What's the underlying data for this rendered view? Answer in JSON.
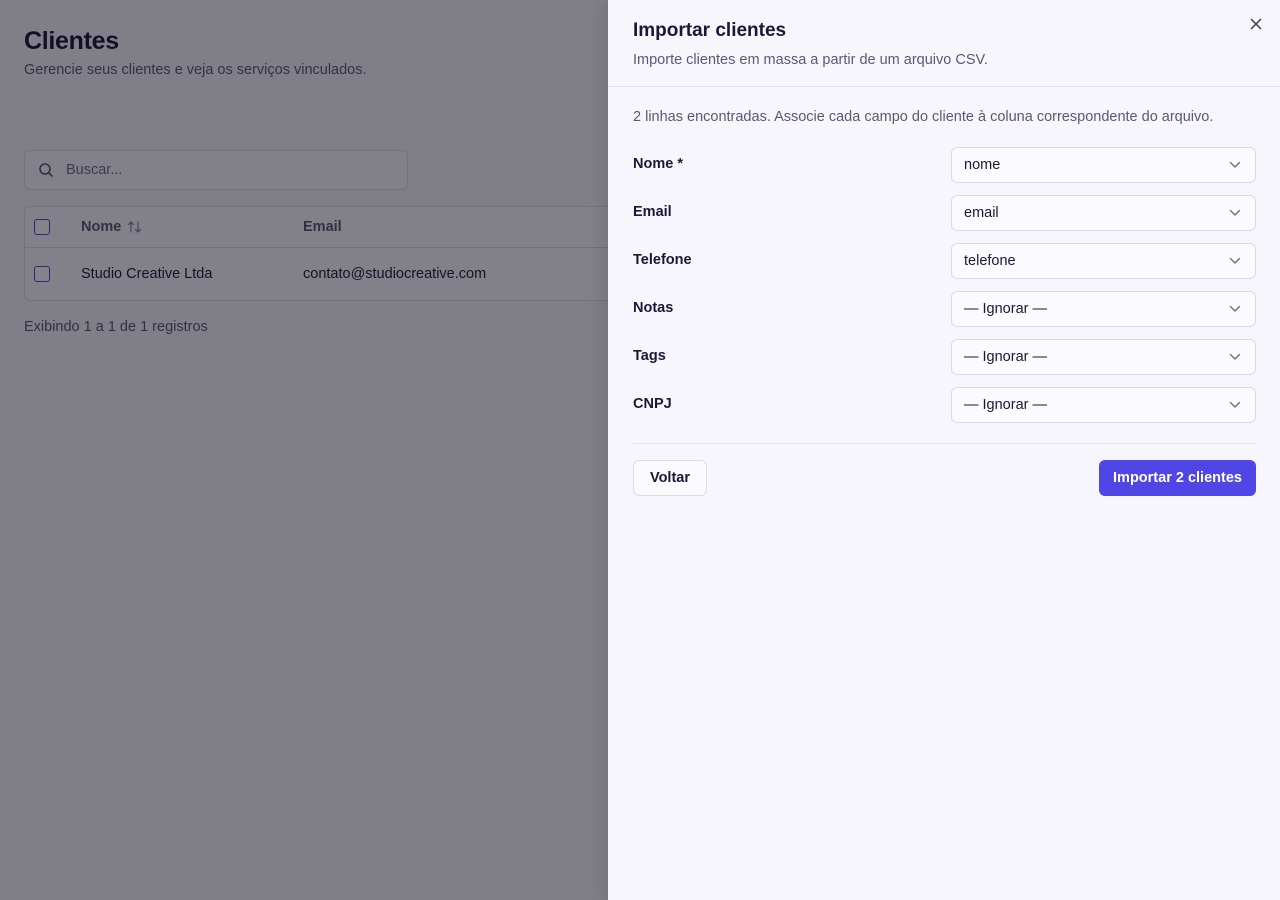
{
  "page": {
    "title": "Clientes",
    "subtitle": "Gerencie seus clientes e veja os serviços vinculados.",
    "search": {
      "placeholder": "Buscar..."
    },
    "table": {
      "columns": [
        "Nome",
        "Email"
      ],
      "rows": [
        {
          "nome": "Studio Creative Ltda",
          "email": "contato@studiocreative.com"
        }
      ]
    },
    "footer": "Exibindo 1 a 1 de 1 registros"
  },
  "sheet": {
    "title": "Importar clientes",
    "description": "Importe clientes em massa a partir de um arquivo CSV.",
    "info": "2 linhas encontradas. Associe cada campo do cliente à coluna correspondente do arquivo.",
    "fields": [
      {
        "label": "Nome *",
        "value": "nome"
      },
      {
        "label": "Email",
        "value": "email"
      },
      {
        "label": "Telefone",
        "value": "telefone"
      },
      {
        "label": "Notas",
        "value": "— Ignorar —"
      },
      {
        "label": "Tags",
        "value": "— Ignorar —"
      },
      {
        "label": "CNPJ",
        "value": "— Ignorar —"
      }
    ],
    "back_label": "Voltar",
    "import_label": "Importar 2 clientes"
  },
  "colors": {
    "accent": "#4f46e5",
    "background": "#f7f6fd",
    "overlay": "rgba(10, 8, 20, 0.50)"
  },
  "icons": {
    "search": "search-icon",
    "sort": "sort-icon",
    "close": "close-icon",
    "chevron": "chevron-down-icon"
  }
}
